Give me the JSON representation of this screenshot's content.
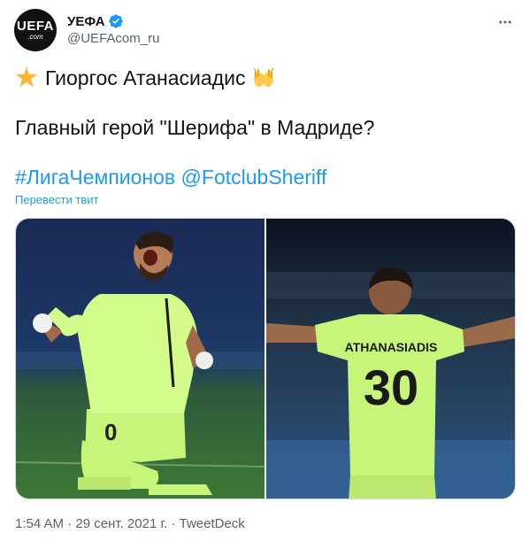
{
  "account": {
    "display_name": "УЕФА",
    "handle": "@UEFAcom_ru",
    "avatar_text_main": "UEFA",
    "avatar_text_sub": ".com"
  },
  "tweet": {
    "line1_text": "Гиоргос Атанасиадис",
    "line2_text": "Главный герой \"Шерифа\" в Мадриде?",
    "hashtag": "#ЛигаЧемпионов",
    "mention": "@FotclubSheriff",
    "translate_label": "Перевести твит"
  },
  "media": {
    "left_photo": {
      "jersey_number": "0"
    },
    "right_photo": {
      "jersey_name": "ATHANASIADIS",
      "jersey_number": "30"
    }
  },
  "meta": {
    "time": "1:54 AM",
    "separator": "·",
    "date": "29 сент. 2021 г.",
    "source": "TweetDeck"
  },
  "colors": {
    "link": "#1d9bf0",
    "secondary_text": "#536471",
    "jersey": "#c6f57a",
    "pitch_dark": "#1a3a5c",
    "grass": "#3b6b32"
  }
}
